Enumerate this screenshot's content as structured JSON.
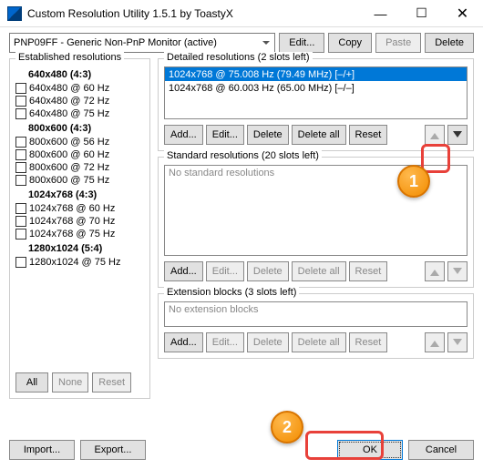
{
  "window": {
    "title": "Custom Resolution Utility 1.5.1 by ToastyX"
  },
  "monitor": {
    "selected": "PNP09FF - Generic Non-PnP Monitor (active)"
  },
  "toolbar": {
    "edit": "Edit...",
    "copy": "Copy",
    "paste": "Paste",
    "delete": "Delete"
  },
  "established": {
    "title": "Established resolutions",
    "groups": [
      {
        "header": "640x480 (4:3)",
        "items": [
          "640x480 @ 60 Hz",
          "640x480 @ 72 Hz",
          "640x480 @ 75 Hz"
        ]
      },
      {
        "header": "800x600 (4:3)",
        "items": [
          "800x600 @ 56 Hz",
          "800x600 @ 60 Hz",
          "800x600 @ 72 Hz",
          "800x600 @ 75 Hz"
        ]
      },
      {
        "header": "1024x768 (4:3)",
        "items": [
          "1024x768 @ 60 Hz",
          "1024x768 @ 70 Hz",
          "1024x768 @ 75 Hz"
        ]
      },
      {
        "header": "1280x1024 (5:4)",
        "items": [
          "1280x1024 @ 75 Hz"
        ]
      }
    ],
    "all": "All",
    "none": "None",
    "reset": "Reset"
  },
  "detailed": {
    "title": "Detailed resolutions (2 slots left)",
    "items": [
      "1024x768 @ 75.008 Hz (79.49 MHz) [–/+]",
      "1024x768 @ 60.003 Hz (65.00 MHz) [–/–]"
    ]
  },
  "standard": {
    "title": "Standard resolutions (20 slots left)",
    "empty": "No standard resolutions"
  },
  "extension": {
    "title": "Extension blocks (3 slots left)",
    "empty": "No extension blocks"
  },
  "btns": {
    "add": "Add...",
    "edit": "Edit...",
    "delete": "Delete",
    "deleteAll": "Delete all",
    "reset": "Reset"
  },
  "footer": {
    "import": "Import...",
    "export": "Export...",
    "ok": "OK",
    "cancel": "Cancel"
  },
  "callouts": {
    "c1": "1",
    "c2": "2"
  }
}
